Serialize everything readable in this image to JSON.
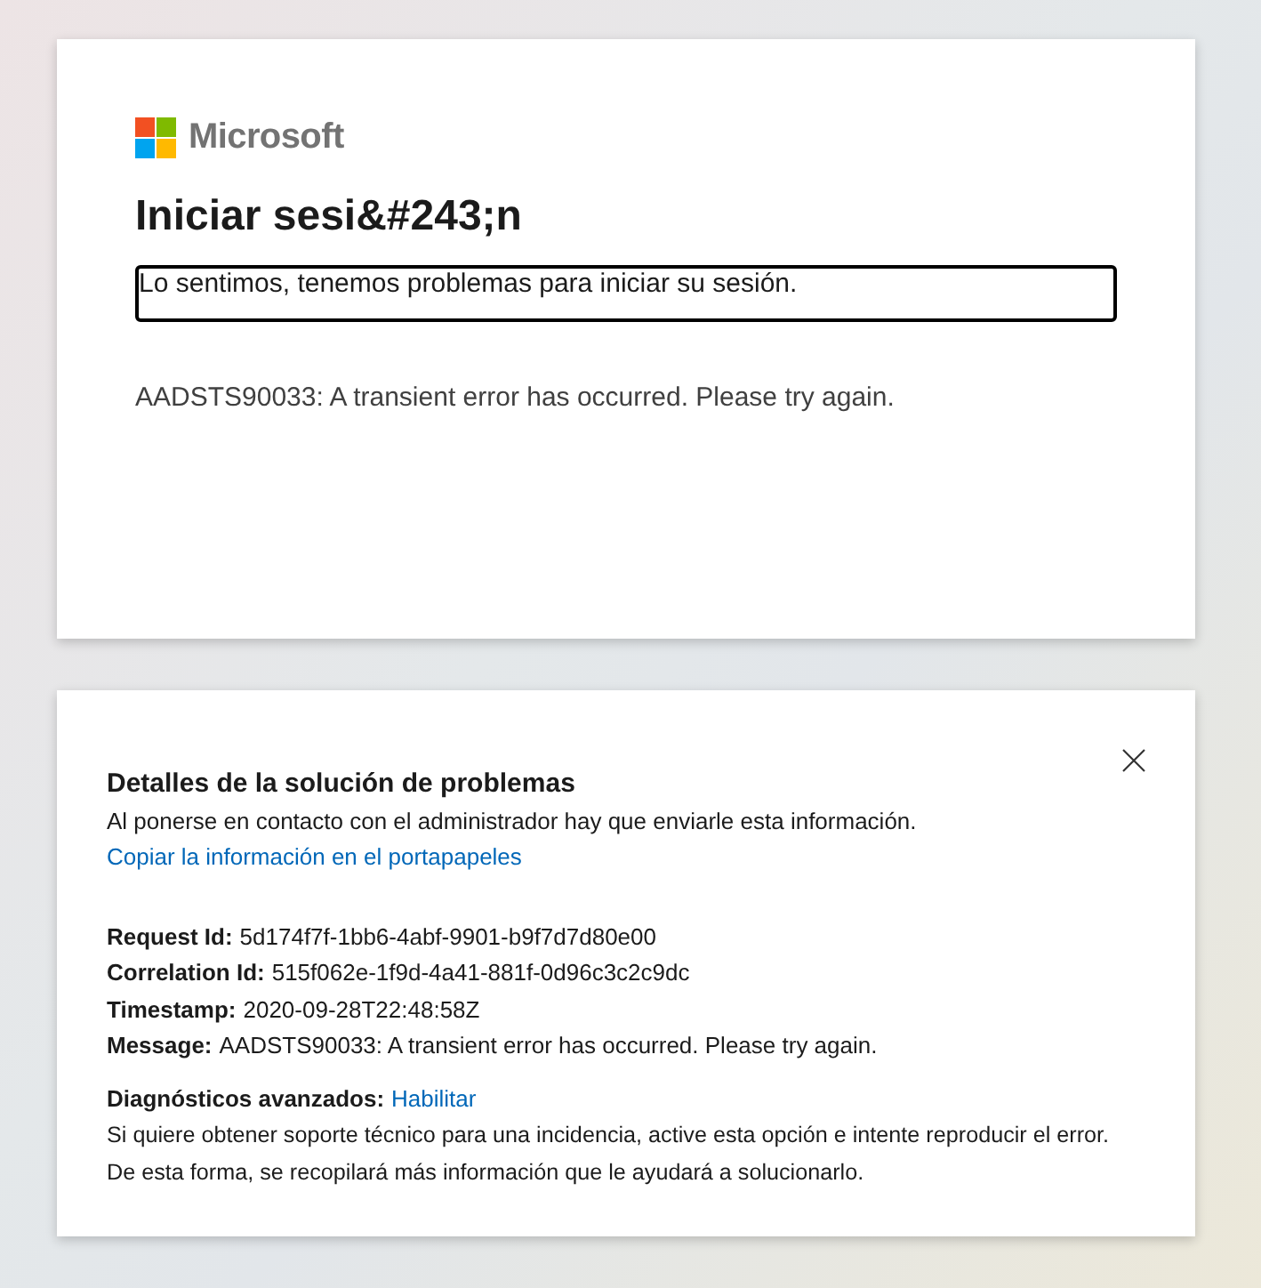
{
  "sign_in_card": {
    "logo_text": "Microsoft",
    "title": "Iniciar sesi&#243;n",
    "notice": "Lo sentimos, tenemos problemas para iniciar su sesión.",
    "error": "AADSTS90033: A transient error has occurred. Please try again."
  },
  "details_panel": {
    "title": "Detalles de la solución de problemas",
    "description": "Al ponerse en contacto con el administrador hay que enviarle esta información.",
    "copy_link": "Copiar la información en el portapapeles",
    "fields": [
      {
        "label": "Request Id:",
        "value": "5d174f7f-1bb6-4abf-9901-b9f7d7d80e00"
      },
      {
        "label": "Correlation Id:",
        "value": "515f062e-1f9d-4a41-881f-0d96c3c2c9dc"
      },
      {
        "label": "Timestamp:",
        "value": "2020-09-28T22:48:58Z"
      },
      {
        "label": "Message:",
        "value": "AADSTS90033: A transient error has occurred. Please try again."
      }
    ],
    "diagnostics": {
      "label": "Diagnósticos avanzados:",
      "link": "Habilitar",
      "description": [
        "Si quiere obtener soporte técnico para una incidencia, active esta opción e intente reproducir el error.",
        "De esta forma, se recopilará más información que le ayudará a solucionarlo."
      ]
    }
  }
}
